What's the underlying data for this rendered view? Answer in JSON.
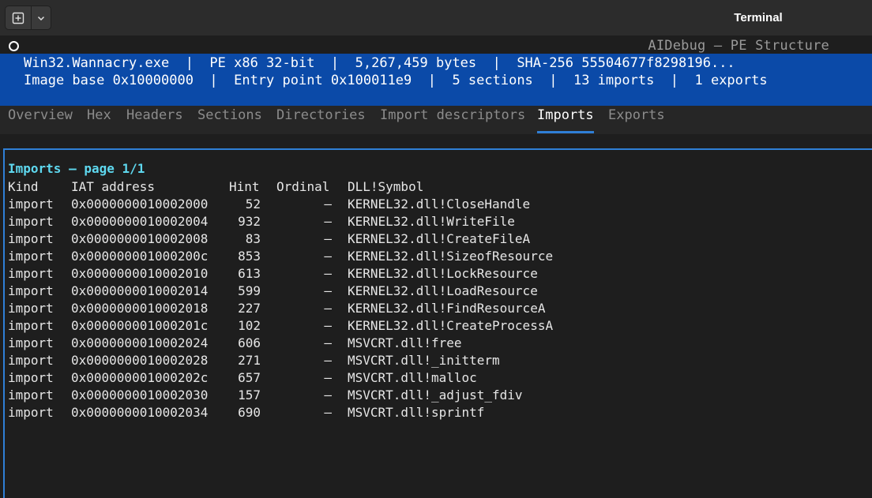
{
  "window": {
    "title": "Terminal"
  },
  "app": {
    "title": "AIDebug — PE Structure",
    "info_line1": "Win32.Wannacry.exe  |  PE x86 32-bit  |  5,267,459 bytes  |  SHA-256 55504677f8298196...",
    "info_line2": "Image base 0x10000000  |  Entry point 0x100011e9  |  5 sections  |  13 imports  |  1 exports"
  },
  "tabs": [
    {
      "label": "Overview",
      "active": false
    },
    {
      "label": "Hex",
      "active": false
    },
    {
      "label": "Headers",
      "active": false
    },
    {
      "label": "Sections",
      "active": false
    },
    {
      "label": "Directories",
      "active": false
    },
    {
      "label": "Import descriptors",
      "active": false
    },
    {
      "label": "Imports",
      "active": true
    },
    {
      "label": "Exports",
      "active": false
    }
  ],
  "imports": {
    "heading": "Imports — page 1/1",
    "columns": [
      "Kind",
      "IAT address",
      "Hint",
      "Ordinal",
      "DLL!Symbol"
    ],
    "rows": [
      [
        "import",
        "0x0000000010002000",
        "52",
        "—",
        "KERNEL32.dll!CloseHandle"
      ],
      [
        "import",
        "0x0000000010002004",
        "932",
        "—",
        "KERNEL32.dll!WriteFile"
      ],
      [
        "import",
        "0x0000000010002008",
        "83",
        "—",
        "KERNEL32.dll!CreateFileA"
      ],
      [
        "import",
        "0x000000001000200c",
        "853",
        "—",
        "KERNEL32.dll!SizeofResource"
      ],
      [
        "import",
        "0x0000000010002010",
        "613",
        "—",
        "KERNEL32.dll!LockResource"
      ],
      [
        "import",
        "0x0000000010002014",
        "599",
        "—",
        "KERNEL32.dll!LoadResource"
      ],
      [
        "import",
        "0x0000000010002018",
        "227",
        "—",
        "KERNEL32.dll!FindResourceA"
      ],
      [
        "import",
        "0x000000001000201c",
        "102",
        "—",
        "KERNEL32.dll!CreateProcessA"
      ],
      [
        "import",
        "0x0000000010002024",
        "606",
        "—",
        "MSVCRT.dll!free"
      ],
      [
        "import",
        "0x0000000010002028",
        "271",
        "—",
        "MSVCRT.dll!_initterm"
      ],
      [
        "import",
        "0x000000001000202c",
        "657",
        "—",
        "MSVCRT.dll!malloc"
      ],
      [
        "import",
        "0x0000000010002030",
        "157",
        "—",
        "MSVCRT.dll!_adjust_fdiv"
      ],
      [
        "import",
        "0x0000000010002034",
        "690",
        "—",
        "MSVCRT.dll!sprintf"
      ]
    ]
  },
  "colors": {
    "infobar_bg": "#0b4aa8",
    "accent": "#2f7fd6",
    "heading": "#5ed8ef"
  }
}
